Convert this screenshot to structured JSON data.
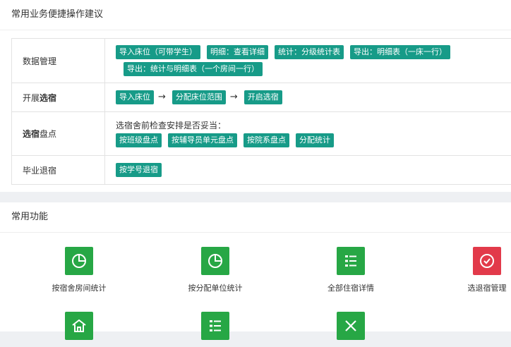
{
  "section1": {
    "title": "常用业务便捷操作建议",
    "rows": [
      {
        "label": "数据管理",
        "tags": [
          "导入床位（可带学生）",
          "明细：查看详细",
          "统计：分级统计表",
          "导出：明细表（一床一行）",
          "导出：统计与明细表（一个房间一行）"
        ]
      },
      {
        "label_pre": "开展",
        "label_bold": "选宿",
        "steps": [
          "导入床位",
          "分配床位范围",
          "开启选宿"
        ],
        "arrow": "→"
      },
      {
        "label_bold": "选宿",
        "label_post": "盘点",
        "note": "选宿舍前检查安排是否妥当：",
        "tags": [
          "按班级盘点",
          "按辅导员单元盘点",
          "按院系盘点",
          "分配统计"
        ]
      },
      {
        "label": "毕业退宿",
        "tags": [
          "按学号退宿"
        ]
      }
    ]
  },
  "section2": {
    "title": "常用功能",
    "items": [
      {
        "label": "按宿舍房间统计",
        "icon": "pie-chart-icon",
        "color": "#27a745"
      },
      {
        "label": "按分配单位统计",
        "icon": "pie-chart-icon",
        "color": "#27a745"
      },
      {
        "label": "全部住宿详情",
        "icon": "list-icon",
        "color": "#27a745"
      },
      {
        "label": "选退宿管理",
        "icon": "check-circle-icon",
        "color": "#e23a4a"
      },
      {
        "label": "",
        "icon": "home-icon",
        "color": "#27a745"
      },
      {
        "label": "",
        "icon": "list-icon",
        "color": "#27a745"
      },
      {
        "label": "",
        "icon": "close-icon",
        "color": "#27a745"
      }
    ]
  }
}
